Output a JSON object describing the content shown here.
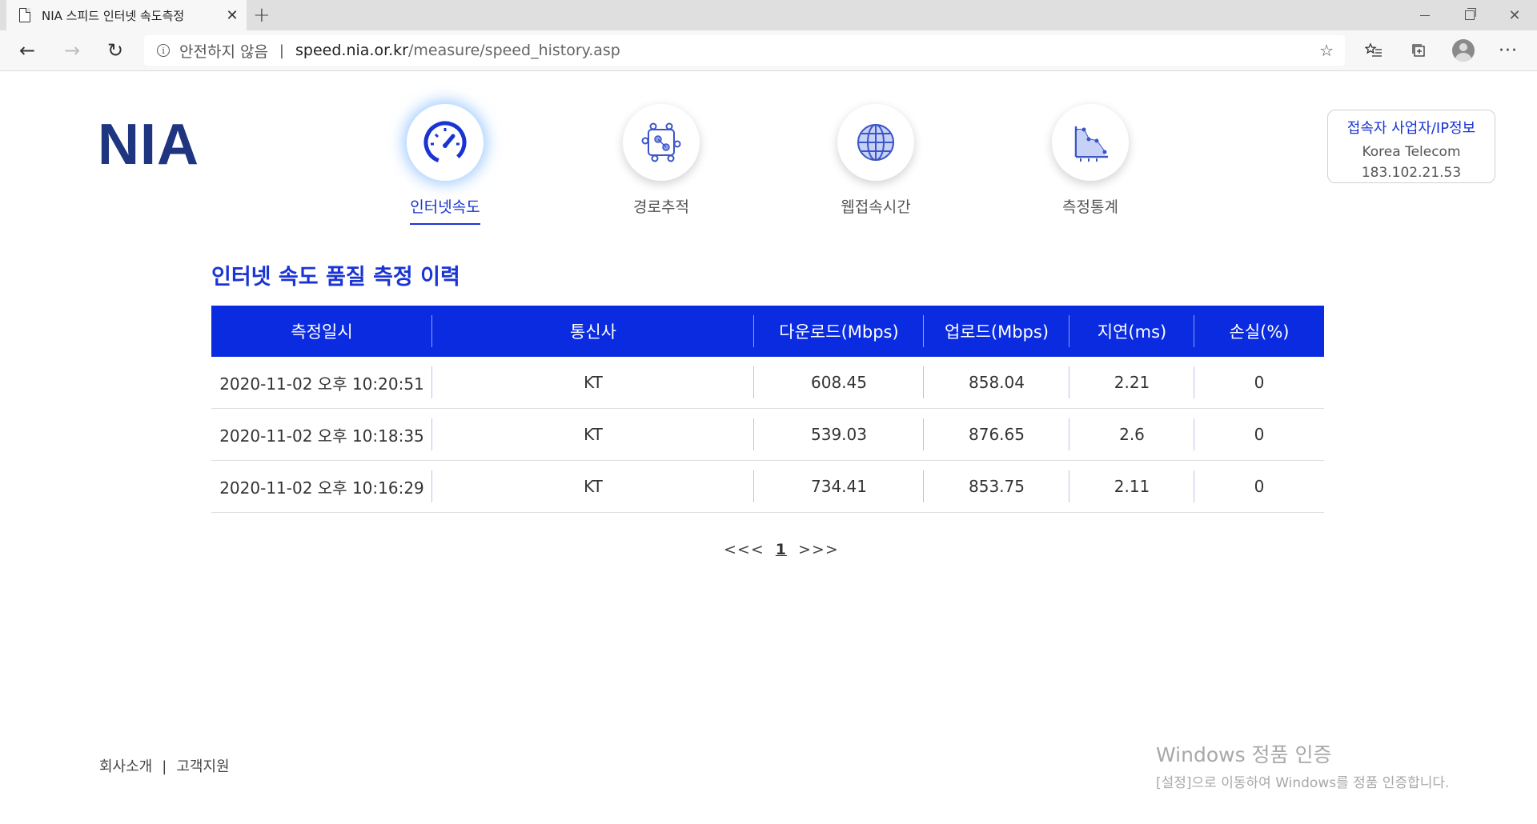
{
  "browser": {
    "tab_title": "NIA 스피드 인터넷 속도측정",
    "security_label": "안전하지 않음",
    "url_host": "speed.nia.or.kr",
    "url_path": "/measure/speed_history.asp"
  },
  "site": {
    "logo": "NIA",
    "menu": [
      {
        "label": "인터넷속도",
        "icon": "speedometer-icon",
        "active": true
      },
      {
        "label": "경로추적",
        "icon": "route-trace-icon",
        "active": false
      },
      {
        "label": "웹접속시간",
        "icon": "globe-icon",
        "active": false
      },
      {
        "label": "측정통계",
        "icon": "statistics-icon",
        "active": false
      }
    ],
    "isp_info": {
      "title": "접속자 사업자/IP정보",
      "provider": "Korea Telecom",
      "ip": "183.102.21.53"
    }
  },
  "history": {
    "title": "인터넷 속도 품질 측정 이력",
    "columns": [
      "측정일시",
      "통신사",
      "다운로드(Mbps)",
      "업로드(Mbps)",
      "지연(ms)",
      "손실(%)"
    ],
    "rows": [
      [
        "2020-11-02 오후 10:20:51",
        "KT",
        "608.45",
        "858.04",
        "2.21",
        "0"
      ],
      [
        "2020-11-02 오후 10:18:35",
        "KT",
        "539.03",
        "876.65",
        "2.6",
        "0"
      ],
      [
        "2020-11-02 오후 10:16:29",
        "KT",
        "734.41",
        "853.75",
        "2.11",
        "0"
      ]
    ],
    "pager": {
      "prev": "<<<",
      "current": "1",
      "next": ">>>"
    }
  },
  "footer": {
    "about": "회사소개",
    "separator": "|",
    "support": "고객지원"
  },
  "watermark": {
    "title": "Windows 정품 인증",
    "subtitle": "[설정]으로 이동하여 Windows를 정품 인증합니다."
  },
  "colors": {
    "accent": "#1a34d4",
    "table_header": "#0a2be0",
    "logo": "#1f3580"
  }
}
